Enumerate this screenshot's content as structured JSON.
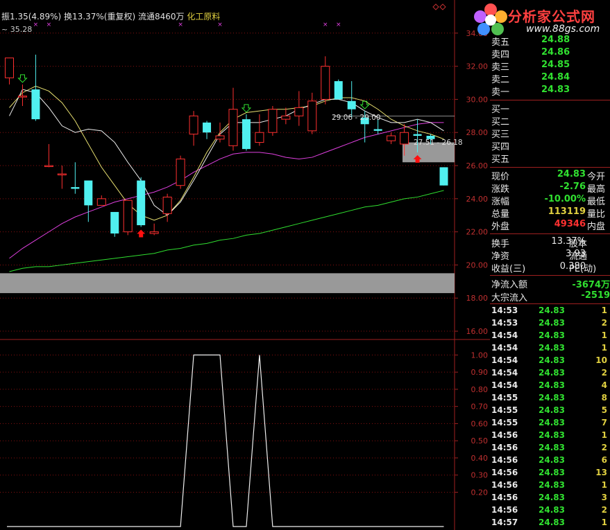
{
  "infobar": {
    "amplitude": "振1.35(4.89%)",
    "turnover": "换13.37%(重复权)",
    "float": "流通8460万",
    "sector": "化工原料"
  },
  "corner_value": "~ 35.28",
  "logo": {
    "title": "分析家公式网",
    "url": "www.88gs.com"
  },
  "chart_labels": {
    "label1": "29.06 - 29.00",
    "label2": "27.51 - 26.18"
  },
  "chart_data": [
    {
      "type": "candlestick",
      "ylim": [
        15.5,
        36
      ],
      "yticks": [
        "16.00",
        "18.00",
        "20.00",
        "22.00",
        "24.00",
        "26.00",
        "28.00",
        "30.00",
        "32.00",
        "34.00"
      ],
      "candles": [
        {
          "o": 31.3,
          "c": 32.5,
          "h": 32.5,
          "l": 30.9,
          "up": true
        },
        {
          "o": 30.2,
          "c": 30.2,
          "h": 30.9,
          "l": 29.6,
          "up": true
        },
        {
          "o": 30.6,
          "c": 28.8,
          "h": 32.7,
          "l": 28.7,
          "up": false
        },
        {
          "o": 26.0,
          "c": 26.0,
          "h": 27.3,
          "l": 25.9,
          "up": true
        },
        {
          "o": 25.5,
          "c": 25.5,
          "h": 26.0,
          "l": 24.6,
          "up": true
        },
        {
          "o": 24.7,
          "c": 24.6,
          "h": 26.2,
          "l": 24.3,
          "up": false
        },
        {
          "o": 25.1,
          "c": 23.6,
          "h": 25.1,
          "l": 22.6,
          "up": false
        },
        {
          "o": 23.6,
          "c": 24.0,
          "h": 24.2,
          "l": 23.6,
          "up": true
        },
        {
          "o": 23.2,
          "c": 21.9,
          "h": 23.2,
          "l": 21.7,
          "up": false
        },
        {
          "o": 22.0,
          "c": 23.9,
          "h": 23.9,
          "l": 21.8,
          "up": true
        },
        {
          "o": 25.1,
          "c": 22.4,
          "h": 25.3,
          "l": 22.3,
          "up": false
        },
        {
          "o": 21.9,
          "c": 22.0,
          "h": 22.5,
          "l": 21.8,
          "up": true
        },
        {
          "o": 23.1,
          "c": 24.1,
          "h": 24.3,
          "l": 22.6,
          "up": true
        },
        {
          "o": 24.8,
          "c": 26.4,
          "h": 26.6,
          "l": 24.6,
          "up": true
        },
        {
          "o": 27.9,
          "c": 29.0,
          "h": 29.3,
          "l": 27.2,
          "up": true
        },
        {
          "o": 28.6,
          "c": 28.0,
          "h": 28.7,
          "l": 27.6,
          "up": false
        },
        {
          "o": 27.6,
          "c": 27.8,
          "h": 28.6,
          "l": 27.4,
          "up": true
        },
        {
          "o": 27.2,
          "c": 29.4,
          "h": 30.7,
          "l": 26.9,
          "up": true
        },
        {
          "o": 28.8,
          "c": 27.0,
          "h": 29.1,
          "l": 26.9,
          "up": false
        },
        {
          "o": 27.4,
          "c": 28.0,
          "h": 29.1,
          "l": 27.2,
          "up": true
        },
        {
          "o": 28.0,
          "c": 29.4,
          "h": 29.6,
          "l": 27.8,
          "up": true
        },
        {
          "o": 28.8,
          "c": 29.0,
          "h": 29.5,
          "l": 28.5,
          "up": true
        },
        {
          "o": 29.0,
          "c": 29.5,
          "h": 30.5,
          "l": 28.4,
          "up": true
        },
        {
          "o": 28.1,
          "c": 29.9,
          "h": 30.4,
          "l": 27.9,
          "up": true
        },
        {
          "o": 30.0,
          "c": 32.0,
          "h": 32.6,
          "l": 29.7,
          "up": true
        },
        {
          "o": 31.1,
          "c": 30.0,
          "h": 31.2,
          "l": 30.0,
          "up": false
        },
        {
          "o": 29.9,
          "c": 29.4,
          "h": 31.1,
          "l": 28.9,
          "up": false
        },
        {
          "o": 28.9,
          "c": 28.5,
          "h": 29.3,
          "l": 27.4,
          "up": false
        },
        {
          "o": 28.2,
          "c": 28.1,
          "h": 28.8,
          "l": 27.9,
          "up": false
        },
        {
          "o": 27.5,
          "c": 27.8,
          "h": 28.0,
          "l": 27.3,
          "up": true
        },
        {
          "o": 27.3,
          "c": 28.0,
          "h": 28.5,
          "l": 26.6,
          "up": true
        },
        {
          "o": 27.9,
          "c": 27.8,
          "h": 28.8,
          "l": 26.8,
          "up": false
        },
        {
          "o": 27.8,
          "c": 27.6,
          "h": 27.9,
          "l": 27.3,
          "up": false
        },
        {
          "o": 25.9,
          "c": 24.8,
          "h": 25.9,
          "l": 24.8,
          "up": false
        }
      ],
      "ma_yellow": [
        29.5,
        30.4,
        30.8,
        30.5,
        29.8,
        28.7,
        27.3,
        25.9,
        24.8,
        23.7,
        23.0,
        22.7,
        23.0,
        23.9,
        25.3,
        26.8,
        28.0,
        28.8,
        29.2,
        29.3,
        29.4,
        29.4,
        29.5,
        29.6,
        29.9,
        30.1,
        30.1,
        29.9,
        29.4,
        28.8,
        28.4,
        28.1,
        27.9,
        27.6
      ],
      "ma_white": [
        29.0,
        30.6,
        30.4,
        29.5,
        28.4,
        28.0,
        28.2,
        28.1,
        27.4,
        26.2,
        25.1,
        23.6,
        23.0,
        23.8,
        25.1,
        26.5,
        27.9,
        28.6,
        28.6,
        28.6,
        28.8,
        29.0,
        29.4,
        29.7,
        30.0,
        30.0,
        29.8,
        29.3,
        28.9,
        28.6,
        28.6,
        28.8,
        28.6,
        28.1
      ],
      "ma_magenta": [
        20.4,
        21.0,
        21.5,
        22.0,
        22.5,
        22.9,
        23.2,
        23.5,
        23.8,
        24.0,
        24.2,
        24.4,
        24.7,
        25.1,
        25.6,
        26.0,
        26.4,
        26.7,
        26.8,
        26.8,
        26.7,
        26.5,
        26.4,
        26.5,
        26.8,
        27.1,
        27.4,
        27.7,
        27.9,
        28.1,
        28.3,
        28.5,
        28.6,
        28.6
      ],
      "ma_green": [
        19.6,
        19.8,
        19.9,
        19.9,
        20.0,
        20.1,
        20.2,
        20.3,
        20.4,
        20.5,
        20.6,
        20.7,
        20.9,
        21.0,
        21.2,
        21.3,
        21.5,
        21.6,
        21.8,
        21.9,
        22.1,
        22.3,
        22.5,
        22.7,
        22.9,
        23.1,
        23.3,
        23.5,
        23.6,
        23.8,
        24.0,
        24.1,
        24.3,
        24.5
      ],
      "gray_zones": [
        [
          18.3,
          19.5
        ],
        [
          26.2,
          27.4
        ]
      ],
      "down_arrows": [
        1,
        18,
        27
      ],
      "up_arrows": [
        10,
        31
      ],
      "x_marks": [
        2,
        3,
        13,
        16,
        24,
        25
      ]
    },
    {
      "type": "line",
      "ylim": [
        0,
        1.05
      ],
      "yticks": [
        "0.20",
        "0.30",
        "0.40",
        "0.50",
        "0.60",
        "0.70",
        "0.80",
        "0.90",
        "1.00"
      ],
      "series": [
        {
          "values": [
            0,
            0,
            0,
            0,
            0,
            0,
            0,
            0,
            0,
            0,
            0,
            0,
            0,
            0,
            1,
            1,
            1,
            0,
            0,
            1,
            0,
            0,
            0,
            0,
            0,
            0,
            0,
            0,
            0,
            0,
            0,
            0,
            0,
            0
          ]
        }
      ]
    }
  ],
  "quote": {
    "sell": [
      {
        "label": "卖五",
        "price": "24.88"
      },
      {
        "label": "卖四",
        "price": "24.86"
      },
      {
        "label": "卖三",
        "price": "24.85"
      },
      {
        "label": "卖二",
        "price": "24.84"
      },
      {
        "label": "卖一",
        "price": "24.83"
      }
    ],
    "buy": [
      {
        "label": "买一",
        "price": ""
      },
      {
        "label": "买二",
        "price": ""
      },
      {
        "label": "买三",
        "price": ""
      },
      {
        "label": "买四",
        "price": ""
      },
      {
        "label": "买五",
        "price": ""
      }
    ],
    "stats": [
      {
        "k1": "现价",
        "v1": "24.83",
        "k2": "今开"
      },
      {
        "k1": "涨跌",
        "v1": "-2.76",
        "k2": "最高"
      },
      {
        "k1": "涨幅",
        "v1": "-10.00%",
        "k2": "最低"
      },
      {
        "k1": "总量",
        "v1": "113119",
        "k2": "量比"
      },
      {
        "k1": "外盘",
        "v1": "49346",
        "k2": "内盘"
      }
    ],
    "stats2": [
      {
        "k1": "换手",
        "v1": "13.37%",
        "k2": "股本"
      },
      {
        "k1": "净资",
        "v1": "3.93",
        "k2": "流通"
      },
      {
        "k1": "收益(三)",
        "v1": "0.380",
        "k2": "PE(动)"
      }
    ],
    "flow": [
      {
        "k": "净流入额",
        "v": "-3674万"
      },
      {
        "k": "大宗流入",
        "v": "-2519"
      }
    ],
    "ticks": [
      {
        "t": "14:53",
        "p": "24.83",
        "v": "1"
      },
      {
        "t": "14:53",
        "p": "24.83",
        "v": "2"
      },
      {
        "t": "14:54",
        "p": "24.83",
        "v": "1"
      },
      {
        "t": "14:54",
        "p": "24.83",
        "v": "1"
      },
      {
        "t": "14:54",
        "p": "24.83",
        "v": "10"
      },
      {
        "t": "14:54",
        "p": "24.83",
        "v": "2"
      },
      {
        "t": "14:54",
        "p": "24.83",
        "v": "4"
      },
      {
        "t": "14:55",
        "p": "24.83",
        "v": "8"
      },
      {
        "t": "14:55",
        "p": "24.83",
        "v": "5"
      },
      {
        "t": "14:55",
        "p": "24.83",
        "v": "7"
      },
      {
        "t": "14:56",
        "p": "24.83",
        "v": "1"
      },
      {
        "t": "14:56",
        "p": "24.83",
        "v": "2"
      },
      {
        "t": "14:56",
        "p": "24.83",
        "v": "6"
      },
      {
        "t": "14:56",
        "p": "24.83",
        "v": "13"
      },
      {
        "t": "14:56",
        "p": "24.83",
        "v": "1"
      },
      {
        "t": "14:56",
        "p": "24.83",
        "v": "3"
      },
      {
        "t": "14:56",
        "p": "24.83",
        "v": "2"
      },
      {
        "t": "14:57",
        "p": "24.83",
        "v": "1"
      }
    ]
  },
  "colors": {
    "up": "#ff3030",
    "down": "#50f0f0",
    "grid": "#8a1010",
    "ma_yellow": "#e8e070",
    "ma_white": "#f0f0f0",
    "ma_magenta": "#e040e0",
    "ma_green": "#30e030"
  }
}
